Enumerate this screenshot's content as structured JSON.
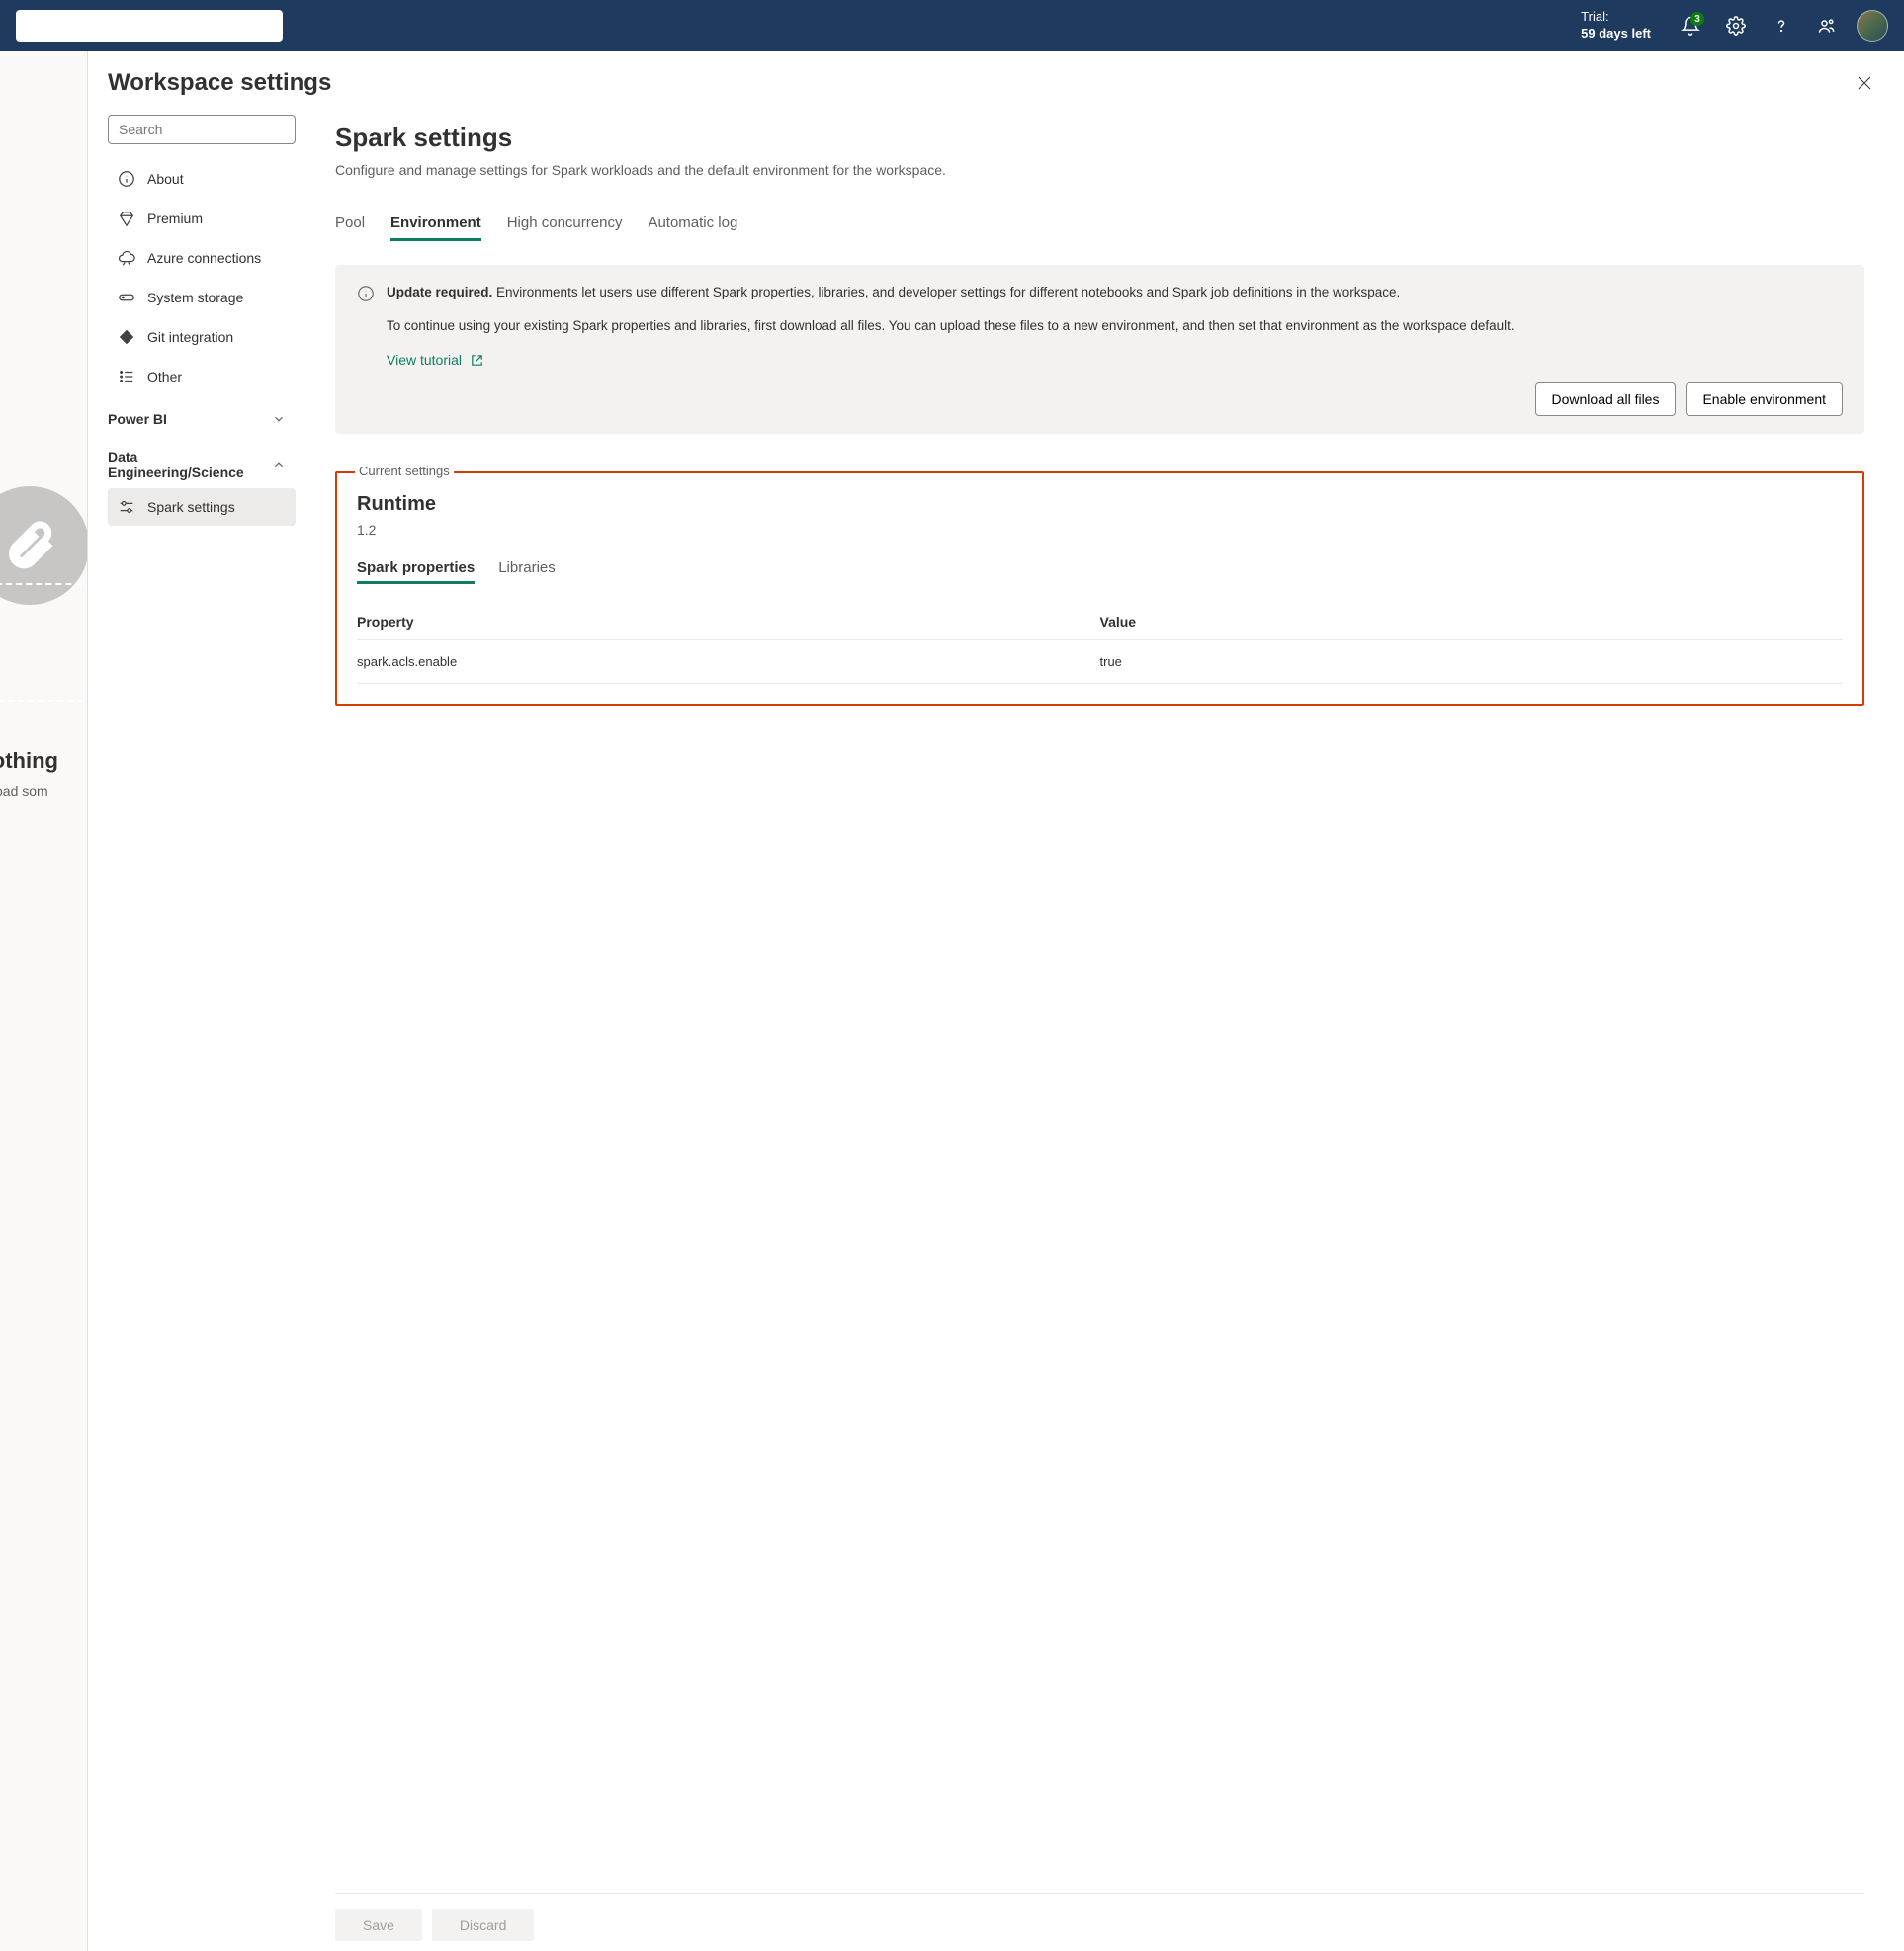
{
  "topbar": {
    "trial_label": "Trial:",
    "trial_days": "59 days left",
    "notification_count": "3"
  },
  "search_placeholder": "Search",
  "background": {
    "text_line1": "s nothing",
    "text_line2": "or upload som"
  },
  "panel_title": "Workspace settings",
  "nav": {
    "items": [
      {
        "label": "About"
      },
      {
        "label": "Premium"
      },
      {
        "label": "Azure connections"
      },
      {
        "label": "System storage"
      },
      {
        "label": "Git integration"
      },
      {
        "label": "Other"
      }
    ],
    "group_powerbi": "Power BI",
    "group_de": "Data Engineering/Science",
    "spark_settings": "Spark settings"
  },
  "content": {
    "heading": "Spark settings",
    "description": "Configure and manage settings for Spark workloads and the default environment for the workspace.",
    "tabs": [
      "Pool",
      "Environment",
      "High concurrency",
      "Automatic log"
    ],
    "info": {
      "strong": "Update required.",
      "p1": " Environments let users use different Spark properties, libraries, and developer settings for different notebooks and Spark job definitions in the workspace.",
      "p2": "To continue using your existing Spark properties and libraries, first download all files. You can upload these files to a new environment, and then set that environment as the workspace default.",
      "view_tutorial": "View tutorial",
      "download_all": "Download all files",
      "enable_env": "Enable environment"
    },
    "fieldset_label": "Current settings",
    "runtime": {
      "heading": "Runtime",
      "version": "1.2",
      "sub_tabs": [
        "Spark properties",
        "Libraries"
      ],
      "table": {
        "h1": "Property",
        "h2": "Value",
        "rows": [
          {
            "prop": "spark.acls.enable",
            "val": "true"
          }
        ]
      }
    },
    "footer": {
      "save": "Save",
      "discard": "Discard"
    }
  }
}
